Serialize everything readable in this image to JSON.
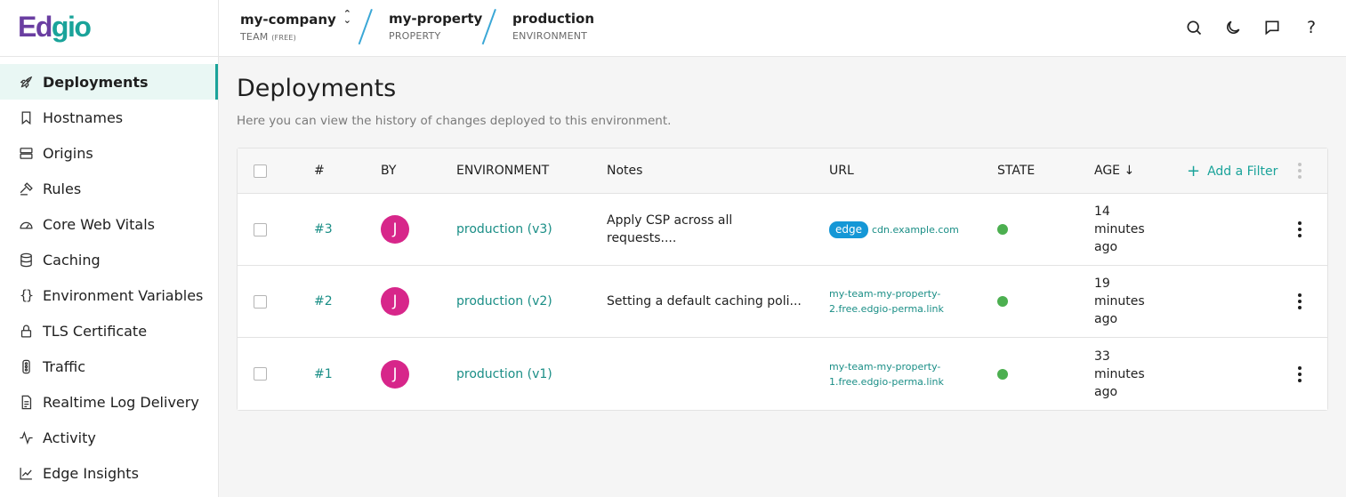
{
  "brand": {
    "logo_part1": "Ed",
    "logo_part2": "gio"
  },
  "breadcrumbs": [
    {
      "name": "my-company",
      "type": "TEAM",
      "badge": "(FREE)"
    },
    {
      "name": "my-property",
      "type": "PROPERTY"
    },
    {
      "name": "production",
      "type": "ENVIRONMENT"
    }
  ],
  "header_icons": [
    "search-icon",
    "moon-icon",
    "chat-icon",
    "help-icon"
  ],
  "header": {
    "help_label": "?"
  },
  "sidebar": {
    "items": [
      {
        "label": "Deployments",
        "icon": "rocket-icon",
        "active": true
      },
      {
        "label": "Hostnames",
        "icon": "bookmark-icon"
      },
      {
        "label": "Origins",
        "icon": "server-icon"
      },
      {
        "label": "Rules",
        "icon": "gavel-icon"
      },
      {
        "label": "Core Web Vitals",
        "icon": "gauge-icon"
      },
      {
        "label": "Caching",
        "icon": "database-icon"
      },
      {
        "label": "Environment Variables",
        "icon": "braces-icon",
        "glyph": "{}"
      },
      {
        "label": "TLS Certificate",
        "icon": "lock-icon"
      },
      {
        "label": "Traffic",
        "icon": "traffic-light-icon"
      },
      {
        "label": "Realtime Log Delivery",
        "icon": "document-icon"
      },
      {
        "label": "Activity",
        "icon": "activity-icon"
      },
      {
        "label": "Edge Insights",
        "icon": "chart-line-icon"
      }
    ]
  },
  "main": {
    "title": "Deployments",
    "description": "Here you can view the history of changes deployed to this environment."
  },
  "table": {
    "columns": {
      "number": "#",
      "by": "BY",
      "environment": "ENVIRONMENT",
      "notes": "Notes",
      "url": "URL",
      "state": "STATE",
      "age": "AGE ↓"
    },
    "add_filter": "Add a Filter",
    "add_filter_plus": "+",
    "rows": [
      {
        "number": "#3",
        "by": "J",
        "environment": "production (v3)",
        "notes": [
          "Apply CSP across all",
          "requests...."
        ],
        "url_badge": "edge",
        "url_lines": [
          "cdn.example.com"
        ],
        "state": "active",
        "age": [
          "14",
          "minutes",
          "ago"
        ]
      },
      {
        "number": "#2",
        "by": "J",
        "environment": "production (v2)",
        "notes": [
          "Setting a default caching poli..."
        ],
        "url_lines": [
          "my-team-my-property-",
          "2.free.edgio-perma.link"
        ],
        "state": "active",
        "age": [
          "19",
          "minutes",
          "ago"
        ]
      },
      {
        "number": "#1",
        "by": "J",
        "environment": "production (v1)",
        "notes": [],
        "url_lines": [
          "my-team-my-property-",
          "1.free.edgio-perma.link"
        ],
        "state": "active",
        "age": [
          "33",
          "minutes",
          "ago"
        ]
      }
    ]
  },
  "colors": {
    "brand_purple": "#6a3ea1",
    "brand_teal": "#1aa39a",
    "link": "#1a8e86",
    "avatar": "#d7268a",
    "state_active": "#4caf50",
    "badge": "#1597d6"
  }
}
